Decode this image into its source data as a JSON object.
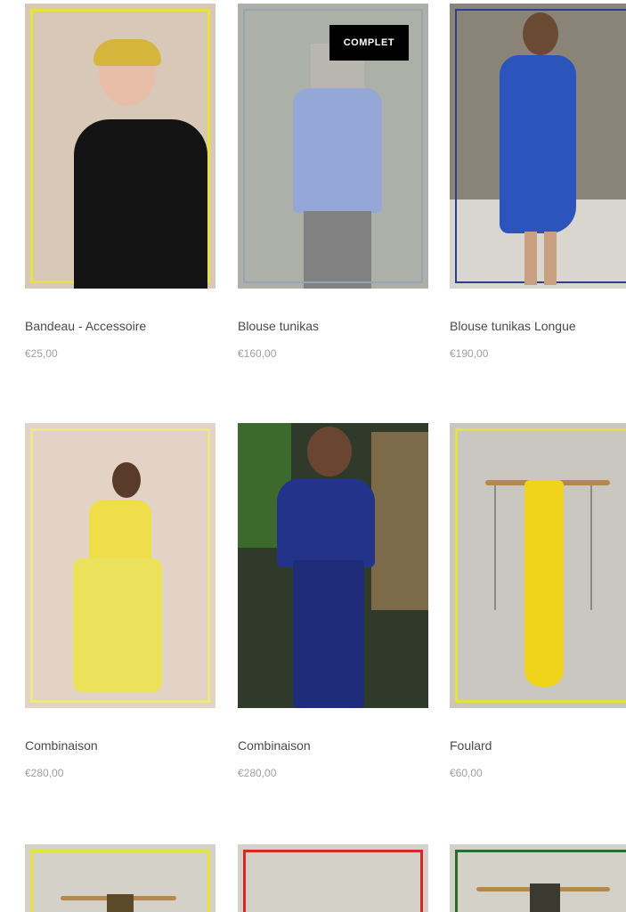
{
  "products": [
    {
      "title": "Bandeau - Accessoire",
      "price": "€25,00"
    },
    {
      "title": "Blouse tunikas",
      "price": "€160,00",
      "badge": "COMPLET"
    },
    {
      "title": "Blouse tunikas Longue",
      "price": "€190,00"
    },
    {
      "title": "Combinaison",
      "price": "€280,00"
    },
    {
      "title": "Combinaison",
      "price": "€280,00"
    },
    {
      "title": "Foulard",
      "price": "€60,00"
    }
  ],
  "colors": {
    "frame_yellow": "#e8e23c",
    "frame_blue": "#2b3f8f",
    "frame_red": "#d8262a",
    "frame_green": "#2d6b2d",
    "title_text": "#4a4a4a",
    "price_text": "#a0a0a0"
  }
}
